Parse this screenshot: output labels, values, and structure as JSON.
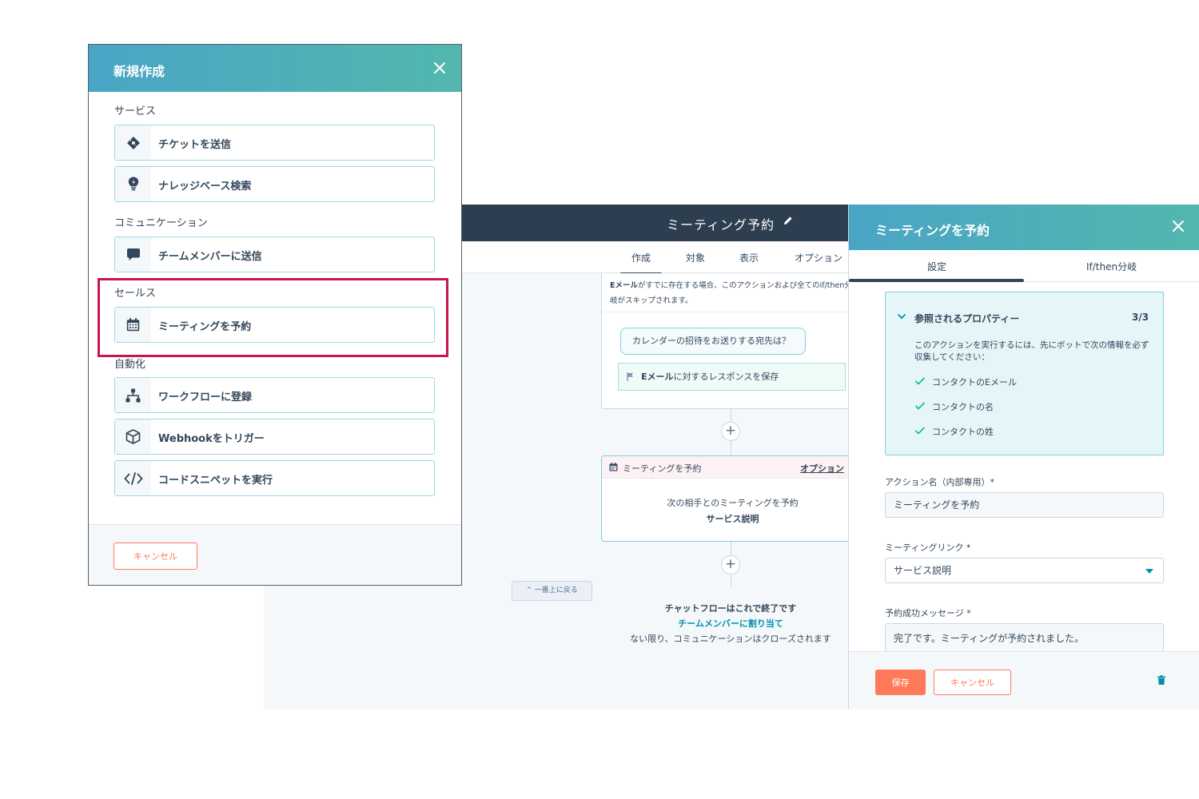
{
  "editor": {
    "title": "ミーティング予約",
    "tabs": [
      "作成",
      "対象",
      "表示",
      "オプション"
    ],
    "card1": {
      "note_bold": "Eメール",
      "note_rest": "がすでに存在する場合、このアクションおよび全てのif/then分岐がスキップされます。",
      "question": "カレンダーの招待をお送りする宛先は？",
      "save_bold": "Eメール",
      "save_rest": "に対するレスポンスを保存"
    },
    "card2": {
      "title": "ミーティングを予約",
      "options": "オプション",
      "line1": "次の相手とのミーティングを予約",
      "line2": "サービス説明"
    },
    "back_top": "一番上に戻る",
    "end": {
      "title": "チャットフローはこれで終了です",
      "link": "チームメンバーに割り当て",
      "desc": "ない限り、コミュニケーションはクローズされます"
    }
  },
  "panel": {
    "title": "ミーティングを予約",
    "tabs": [
      "設定",
      "If/then分岐"
    ],
    "props": {
      "title": "参照されるプロパティー",
      "count": "3/3",
      "desc": "このアクションを実行するには、先にボットで次の情報を必ず収集してください：",
      "items": [
        "コンタクトのEメール",
        "コンタクトの名",
        "コンタクトの姓"
      ]
    },
    "fields": {
      "action_name_label": "アクション名（内部専用）*",
      "action_name_value": "ミーティングを予約",
      "meeting_link_label": "ミーティングリンク *",
      "meeting_link_value": "サービス説明",
      "success_label": "予約成功メッセージ *",
      "success_value": "完了です。ミーティングが予約されました。"
    },
    "save": "保存",
    "cancel": "キャンセル"
  },
  "modal": {
    "title": "新規作成",
    "sections": [
      {
        "label": "サービス",
        "items": [
          {
            "label": "チケットを送信",
            "icon": "ticket-icon"
          },
          {
            "label": "ナレッジベース検索",
            "icon": "lightbulb-icon"
          }
        ]
      },
      {
        "label": "コミュニケーション",
        "items": [
          {
            "label": "チームメンバーに送信",
            "icon": "chat-bubble-icon"
          }
        ]
      },
      {
        "label": "セールス",
        "items": [
          {
            "label": "ミーティングを予約",
            "icon": "calendar-icon"
          }
        ]
      },
      {
        "label": "自動化",
        "items": [
          {
            "label": "ワークフローに登録",
            "icon": "workflow-icon"
          },
          {
            "label": "Webhookをトリガー",
            "icon": "cube-icon"
          },
          {
            "label": "コードスニペットを実行",
            "icon": "code-icon"
          }
        ]
      }
    ],
    "cancel": "キャンセル"
  },
  "colors": {
    "header_gradient_start": "#4aa5c5",
    "header_gradient_end": "#52b7ad",
    "accent_orange": "#ff7a59",
    "highlight": "#c8174c",
    "topbar": "#2d3e50"
  }
}
